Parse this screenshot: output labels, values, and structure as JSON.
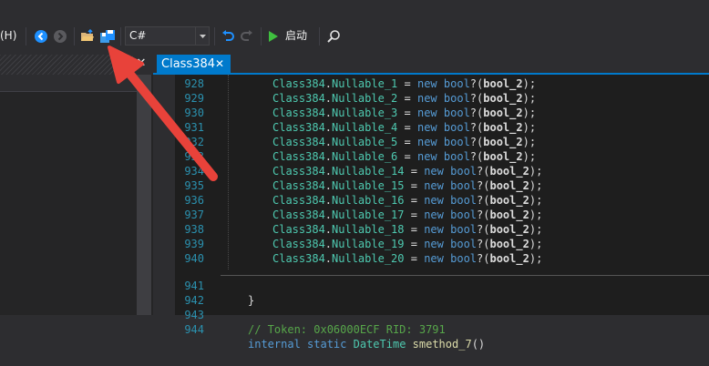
{
  "toolbar": {
    "menu_fragment": "(H)",
    "language_value": "C#",
    "start_label": "启动",
    "icons": [
      "back-icon",
      "forward-icon",
      "open-folder-icon",
      "save-icon",
      "dropdown-arrow-icon",
      "undo-icon",
      "redo-icon",
      "play-icon",
      "search-icon"
    ]
  },
  "left_panel": {
    "close_glyph": "✕"
  },
  "editor": {
    "tab_label": "Class384",
    "tab_close_glyph": "✕",
    "lines": [
      {
        "num": "928",
        "obj": "Class384",
        "field": "Nullable_1"
      },
      {
        "num": "929",
        "obj": "Class384",
        "field": "Nullable_2"
      },
      {
        "num": "930",
        "obj": "Class384",
        "field": "Nullable_3"
      },
      {
        "num": "931",
        "obj": "Class384",
        "field": "Nullable_4"
      },
      {
        "num": "932",
        "obj": "Class384",
        "field": "Nullable_5"
      },
      {
        "num": "933",
        "obj": "Class384",
        "field": "Nullable_6"
      },
      {
        "num": "934",
        "obj": "Class384",
        "field": "Nullable_14"
      },
      {
        "num": "935",
        "obj": "Class384",
        "field": "Nullable_15"
      },
      {
        "num": "936",
        "obj": "Class384",
        "field": "Nullable_16"
      },
      {
        "num": "937",
        "obj": "Class384",
        "field": "Nullable_17"
      },
      {
        "num": "938",
        "obj": "Class384",
        "field": "Nullable_18"
      },
      {
        "num": "939",
        "obj": "Class384",
        "field": "Nullable_19"
      },
      {
        "num": "940",
        "obj": "Class384",
        "field": "Nullable_20"
      }
    ],
    "assign_op": " = ",
    "new_kw": "new",
    "bool_kw": "bool",
    "paren_open": "?(",
    "arg": "bool_2",
    "paren_close": ");",
    "line_941": {
      "num": "941",
      "text": "}"
    },
    "line_942": {
      "num": "942",
      "text": ""
    },
    "line_943": {
      "num": "943",
      "text": "// Token: 0x06000ECF RID: 3791"
    },
    "line_944": {
      "num": "944",
      "kw1": "internal",
      "kw2": "static",
      "type": "DateTime",
      "fn": "smethod_7",
      "rest": "()"
    }
  },
  "colors": {
    "accent": "#007acc",
    "background": "#1e1e1e",
    "line_number": "#2b91af",
    "type": "#4ec9b0",
    "keyword": "#569cd6",
    "comment": "#57a64a",
    "annotation_arrow": "#e8423a"
  }
}
